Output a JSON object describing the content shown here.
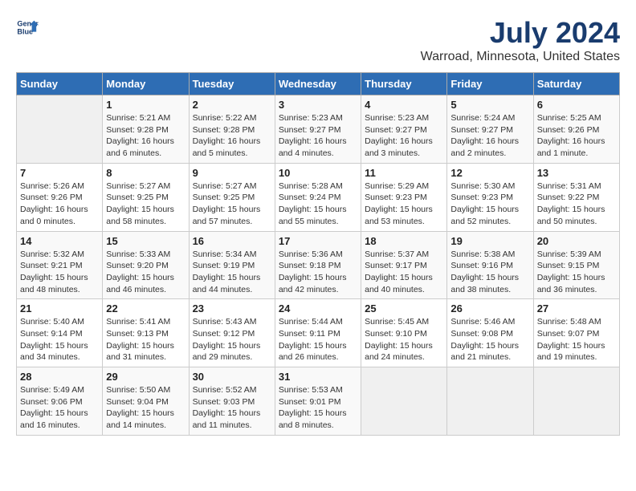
{
  "header": {
    "logo_line1": "General",
    "logo_line2": "Blue",
    "month": "July 2024",
    "location": "Warroad, Minnesota, United States"
  },
  "weekdays": [
    "Sunday",
    "Monday",
    "Tuesday",
    "Wednesday",
    "Thursday",
    "Friday",
    "Saturday"
  ],
  "weeks": [
    [
      {
        "num": "",
        "info": ""
      },
      {
        "num": "1",
        "info": "Sunrise: 5:21 AM\nSunset: 9:28 PM\nDaylight: 16 hours\nand 6 minutes."
      },
      {
        "num": "2",
        "info": "Sunrise: 5:22 AM\nSunset: 9:28 PM\nDaylight: 16 hours\nand 5 minutes."
      },
      {
        "num": "3",
        "info": "Sunrise: 5:23 AM\nSunset: 9:27 PM\nDaylight: 16 hours\nand 4 minutes."
      },
      {
        "num": "4",
        "info": "Sunrise: 5:23 AM\nSunset: 9:27 PM\nDaylight: 16 hours\nand 3 minutes."
      },
      {
        "num": "5",
        "info": "Sunrise: 5:24 AM\nSunset: 9:27 PM\nDaylight: 16 hours\nand 2 minutes."
      },
      {
        "num": "6",
        "info": "Sunrise: 5:25 AM\nSunset: 9:26 PM\nDaylight: 16 hours\nand 1 minute."
      }
    ],
    [
      {
        "num": "7",
        "info": "Sunrise: 5:26 AM\nSunset: 9:26 PM\nDaylight: 16 hours\nand 0 minutes."
      },
      {
        "num": "8",
        "info": "Sunrise: 5:27 AM\nSunset: 9:25 PM\nDaylight: 15 hours\nand 58 minutes."
      },
      {
        "num": "9",
        "info": "Sunrise: 5:27 AM\nSunset: 9:25 PM\nDaylight: 15 hours\nand 57 minutes."
      },
      {
        "num": "10",
        "info": "Sunrise: 5:28 AM\nSunset: 9:24 PM\nDaylight: 15 hours\nand 55 minutes."
      },
      {
        "num": "11",
        "info": "Sunrise: 5:29 AM\nSunset: 9:23 PM\nDaylight: 15 hours\nand 53 minutes."
      },
      {
        "num": "12",
        "info": "Sunrise: 5:30 AM\nSunset: 9:23 PM\nDaylight: 15 hours\nand 52 minutes."
      },
      {
        "num": "13",
        "info": "Sunrise: 5:31 AM\nSunset: 9:22 PM\nDaylight: 15 hours\nand 50 minutes."
      }
    ],
    [
      {
        "num": "14",
        "info": "Sunrise: 5:32 AM\nSunset: 9:21 PM\nDaylight: 15 hours\nand 48 minutes."
      },
      {
        "num": "15",
        "info": "Sunrise: 5:33 AM\nSunset: 9:20 PM\nDaylight: 15 hours\nand 46 minutes."
      },
      {
        "num": "16",
        "info": "Sunrise: 5:34 AM\nSunset: 9:19 PM\nDaylight: 15 hours\nand 44 minutes."
      },
      {
        "num": "17",
        "info": "Sunrise: 5:36 AM\nSunset: 9:18 PM\nDaylight: 15 hours\nand 42 minutes."
      },
      {
        "num": "18",
        "info": "Sunrise: 5:37 AM\nSunset: 9:17 PM\nDaylight: 15 hours\nand 40 minutes."
      },
      {
        "num": "19",
        "info": "Sunrise: 5:38 AM\nSunset: 9:16 PM\nDaylight: 15 hours\nand 38 minutes."
      },
      {
        "num": "20",
        "info": "Sunrise: 5:39 AM\nSunset: 9:15 PM\nDaylight: 15 hours\nand 36 minutes."
      }
    ],
    [
      {
        "num": "21",
        "info": "Sunrise: 5:40 AM\nSunset: 9:14 PM\nDaylight: 15 hours\nand 34 minutes."
      },
      {
        "num": "22",
        "info": "Sunrise: 5:41 AM\nSunset: 9:13 PM\nDaylight: 15 hours\nand 31 minutes."
      },
      {
        "num": "23",
        "info": "Sunrise: 5:43 AM\nSunset: 9:12 PM\nDaylight: 15 hours\nand 29 minutes."
      },
      {
        "num": "24",
        "info": "Sunrise: 5:44 AM\nSunset: 9:11 PM\nDaylight: 15 hours\nand 26 minutes."
      },
      {
        "num": "25",
        "info": "Sunrise: 5:45 AM\nSunset: 9:10 PM\nDaylight: 15 hours\nand 24 minutes."
      },
      {
        "num": "26",
        "info": "Sunrise: 5:46 AM\nSunset: 9:08 PM\nDaylight: 15 hours\nand 21 minutes."
      },
      {
        "num": "27",
        "info": "Sunrise: 5:48 AM\nSunset: 9:07 PM\nDaylight: 15 hours\nand 19 minutes."
      }
    ],
    [
      {
        "num": "28",
        "info": "Sunrise: 5:49 AM\nSunset: 9:06 PM\nDaylight: 15 hours\nand 16 minutes."
      },
      {
        "num": "29",
        "info": "Sunrise: 5:50 AM\nSunset: 9:04 PM\nDaylight: 15 hours\nand 14 minutes."
      },
      {
        "num": "30",
        "info": "Sunrise: 5:52 AM\nSunset: 9:03 PM\nDaylight: 15 hours\nand 11 minutes."
      },
      {
        "num": "31",
        "info": "Sunrise: 5:53 AM\nSunset: 9:01 PM\nDaylight: 15 hours\nand 8 minutes."
      },
      {
        "num": "",
        "info": ""
      },
      {
        "num": "",
        "info": ""
      },
      {
        "num": "",
        "info": ""
      }
    ]
  ]
}
